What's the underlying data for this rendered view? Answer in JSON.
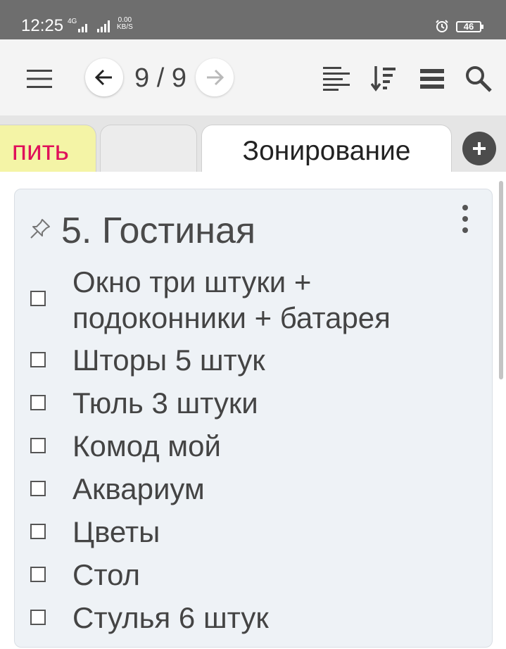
{
  "status_bar": {
    "time": "12:25",
    "network": "4G",
    "speed_value": "0.00",
    "speed_unit": "KB/S",
    "battery": "46"
  },
  "toolbar": {
    "page_counter": "9 / 9",
    "icons": [
      "menu-icon",
      "arrow-left-icon",
      "arrow-right-icon",
      "align-left-icon",
      "sort-icon",
      "view-list-icon",
      "search-icon"
    ]
  },
  "tabs": [
    {
      "label": "пить",
      "color": "#f4f4a6",
      "text_color": "#e0105a"
    },
    {
      "label": "",
      "color": "#ececec"
    },
    {
      "label": "Зонирование",
      "color": "#ffffff",
      "active": true
    }
  ],
  "note": {
    "title": "5. Гостиная",
    "checklist": [
      "Окно три штуки + подоконники + батарея",
      "Шторы 5 штук",
      "Тюль 3 штуки",
      "Комод мой",
      "Аквариум",
      "Цветы",
      "Стол",
      "Стулья 6 штук"
    ]
  }
}
